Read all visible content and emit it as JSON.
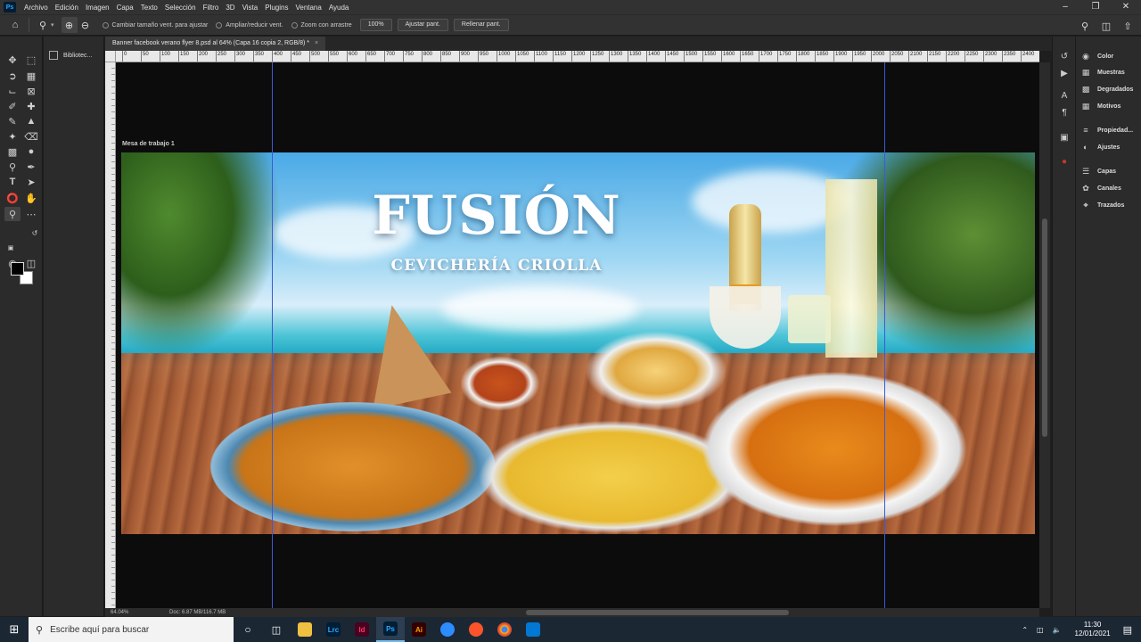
{
  "menu": {
    "items": [
      "Archivo",
      "Edición",
      "Imagen",
      "Capa",
      "Texto",
      "Selección",
      "Filtro",
      "3D",
      "Vista",
      "Plugins",
      "Ventana",
      "Ayuda"
    ]
  },
  "options": {
    "resize_windows": "Cambiar tamaño vent. para ajustar",
    "zoom_all": "Ampliar/reducir vent.",
    "scrubby_zoom": "Zoom con arrastre",
    "zoom_value": "100%",
    "fit_screen": "Ajustar pant.",
    "fill_screen": "Rellenar pant."
  },
  "libraries": {
    "label": "Bibliotec..."
  },
  "document": {
    "tab_title": "Banner facebook verano flyer 8.psd al 64% (Capa 16 copia 2, RGB/8) *",
    "artboard_label": "Mesa de trabajo 1"
  },
  "ruler": {
    "top_labels": [
      "0",
      "50",
      "100",
      "150",
      "200",
      "250",
      "300",
      "350",
      "400",
      "450",
      "500",
      "550",
      "600",
      "650",
      "700",
      "750",
      "800",
      "850",
      "900",
      "950",
      "1000",
      "1050",
      "1100",
      "1150",
      "1200",
      "1250",
      "1300",
      "1350",
      "1400",
      "1450",
      "1500",
      "1550",
      "1600",
      "1650",
      "1700",
      "1750",
      "1800",
      "1850",
      "1900",
      "1950",
      "2000",
      "2050",
      "2100",
      "2150",
      "2200",
      "2250",
      "2300",
      "2350",
      "2400",
      "2450"
    ]
  },
  "banner": {
    "title": "FUSIÓN",
    "subtitle": "CEVICHERÍA CRIOLLA"
  },
  "status": {
    "zoom": "64.04%",
    "doc": "Doc: 6.87 MB/116.7 MB"
  },
  "panels": {
    "group1": [
      "Color",
      "Muestras",
      "Degradados",
      "Motivos"
    ],
    "group2": [
      "Propiedad...",
      "Ajustes"
    ],
    "group3": [
      "Capas",
      "Canales",
      "Trazados"
    ]
  },
  "taskbar": {
    "search_placeholder": "Escribe aquí para buscar",
    "apps": [
      "Lrc",
      "Id",
      "Ps",
      "Ai"
    ],
    "time": "11:30",
    "date": "12/01/2021"
  },
  "colors": {
    "foreground": "#000000",
    "background": "#ffffff",
    "guide": "#3b5bd6",
    "ps_blue": "#31a8ff"
  }
}
